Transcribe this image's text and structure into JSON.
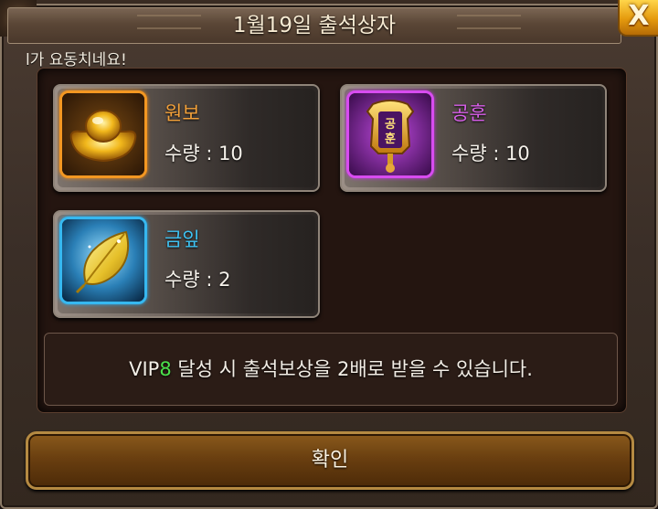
{
  "dialog": {
    "title": "1월19일 출석상자",
    "notice": "l가 요동치네요!",
    "close_label": "X"
  },
  "rewards": [
    {
      "name": "원보",
      "qty_label": "수량 : 10",
      "name_color": "#f3a13a",
      "icon": "gold-ingot-icon"
    },
    {
      "name": "공훈",
      "qty_label": "수량 : 10",
      "name_color": "#d65ee8",
      "icon": "merit-token-icon"
    },
    {
      "name": "금잎",
      "qty_label": "수량 : 2",
      "name_color": "#3ec2f2",
      "icon": "golden-leaf-icon"
    }
  ],
  "vip": {
    "prefix": "VIP",
    "level": "8",
    "message": " 달성 시 출석보상을 2배로 받을 수 있습니다.",
    "level_color": "#4be04b"
  },
  "confirm_label": "확인"
}
